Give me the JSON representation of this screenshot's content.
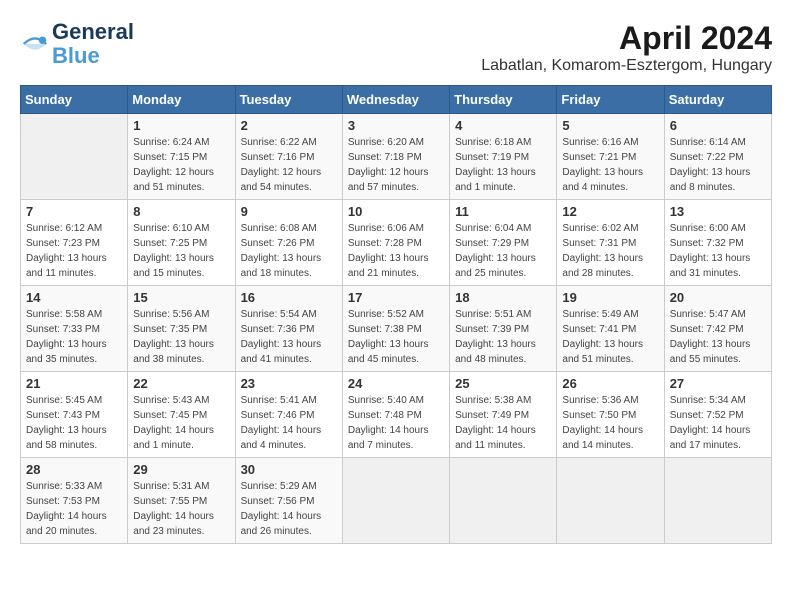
{
  "header": {
    "logo_line1": "General",
    "logo_line2": "Blue",
    "title": "April 2024",
    "subtitle": "Labatlan, Komarom-Esztergom, Hungary"
  },
  "days_of_week": [
    "Sunday",
    "Monday",
    "Tuesday",
    "Wednesday",
    "Thursday",
    "Friday",
    "Saturday"
  ],
  "weeks": [
    [
      {
        "day": "",
        "info": ""
      },
      {
        "day": "1",
        "info": "Sunrise: 6:24 AM\nSunset: 7:15 PM\nDaylight: 12 hours\nand 51 minutes."
      },
      {
        "day": "2",
        "info": "Sunrise: 6:22 AM\nSunset: 7:16 PM\nDaylight: 12 hours\nand 54 minutes."
      },
      {
        "day": "3",
        "info": "Sunrise: 6:20 AM\nSunset: 7:18 PM\nDaylight: 12 hours\nand 57 minutes."
      },
      {
        "day": "4",
        "info": "Sunrise: 6:18 AM\nSunset: 7:19 PM\nDaylight: 13 hours\nand 1 minute."
      },
      {
        "day": "5",
        "info": "Sunrise: 6:16 AM\nSunset: 7:21 PM\nDaylight: 13 hours\nand 4 minutes."
      },
      {
        "day": "6",
        "info": "Sunrise: 6:14 AM\nSunset: 7:22 PM\nDaylight: 13 hours\nand 8 minutes."
      }
    ],
    [
      {
        "day": "7",
        "info": "Sunrise: 6:12 AM\nSunset: 7:23 PM\nDaylight: 13 hours\nand 11 minutes."
      },
      {
        "day": "8",
        "info": "Sunrise: 6:10 AM\nSunset: 7:25 PM\nDaylight: 13 hours\nand 15 minutes."
      },
      {
        "day": "9",
        "info": "Sunrise: 6:08 AM\nSunset: 7:26 PM\nDaylight: 13 hours\nand 18 minutes."
      },
      {
        "day": "10",
        "info": "Sunrise: 6:06 AM\nSunset: 7:28 PM\nDaylight: 13 hours\nand 21 minutes."
      },
      {
        "day": "11",
        "info": "Sunrise: 6:04 AM\nSunset: 7:29 PM\nDaylight: 13 hours\nand 25 minutes."
      },
      {
        "day": "12",
        "info": "Sunrise: 6:02 AM\nSunset: 7:31 PM\nDaylight: 13 hours\nand 28 minutes."
      },
      {
        "day": "13",
        "info": "Sunrise: 6:00 AM\nSunset: 7:32 PM\nDaylight: 13 hours\nand 31 minutes."
      }
    ],
    [
      {
        "day": "14",
        "info": "Sunrise: 5:58 AM\nSunset: 7:33 PM\nDaylight: 13 hours\nand 35 minutes."
      },
      {
        "day": "15",
        "info": "Sunrise: 5:56 AM\nSunset: 7:35 PM\nDaylight: 13 hours\nand 38 minutes."
      },
      {
        "day": "16",
        "info": "Sunrise: 5:54 AM\nSunset: 7:36 PM\nDaylight: 13 hours\nand 41 minutes."
      },
      {
        "day": "17",
        "info": "Sunrise: 5:52 AM\nSunset: 7:38 PM\nDaylight: 13 hours\nand 45 minutes."
      },
      {
        "day": "18",
        "info": "Sunrise: 5:51 AM\nSunset: 7:39 PM\nDaylight: 13 hours\nand 48 minutes."
      },
      {
        "day": "19",
        "info": "Sunrise: 5:49 AM\nSunset: 7:41 PM\nDaylight: 13 hours\nand 51 minutes."
      },
      {
        "day": "20",
        "info": "Sunrise: 5:47 AM\nSunset: 7:42 PM\nDaylight: 13 hours\nand 55 minutes."
      }
    ],
    [
      {
        "day": "21",
        "info": "Sunrise: 5:45 AM\nSunset: 7:43 PM\nDaylight: 13 hours\nand 58 minutes."
      },
      {
        "day": "22",
        "info": "Sunrise: 5:43 AM\nSunset: 7:45 PM\nDaylight: 14 hours\nand 1 minute."
      },
      {
        "day": "23",
        "info": "Sunrise: 5:41 AM\nSunset: 7:46 PM\nDaylight: 14 hours\nand 4 minutes."
      },
      {
        "day": "24",
        "info": "Sunrise: 5:40 AM\nSunset: 7:48 PM\nDaylight: 14 hours\nand 7 minutes."
      },
      {
        "day": "25",
        "info": "Sunrise: 5:38 AM\nSunset: 7:49 PM\nDaylight: 14 hours\nand 11 minutes."
      },
      {
        "day": "26",
        "info": "Sunrise: 5:36 AM\nSunset: 7:50 PM\nDaylight: 14 hours\nand 14 minutes."
      },
      {
        "day": "27",
        "info": "Sunrise: 5:34 AM\nSunset: 7:52 PM\nDaylight: 14 hours\nand 17 minutes."
      }
    ],
    [
      {
        "day": "28",
        "info": "Sunrise: 5:33 AM\nSunset: 7:53 PM\nDaylight: 14 hours\nand 20 minutes."
      },
      {
        "day": "29",
        "info": "Sunrise: 5:31 AM\nSunset: 7:55 PM\nDaylight: 14 hours\nand 23 minutes."
      },
      {
        "day": "30",
        "info": "Sunrise: 5:29 AM\nSunset: 7:56 PM\nDaylight: 14 hours\nand 26 minutes."
      },
      {
        "day": "",
        "info": ""
      },
      {
        "day": "",
        "info": ""
      },
      {
        "day": "",
        "info": ""
      },
      {
        "day": "",
        "info": ""
      }
    ]
  ]
}
